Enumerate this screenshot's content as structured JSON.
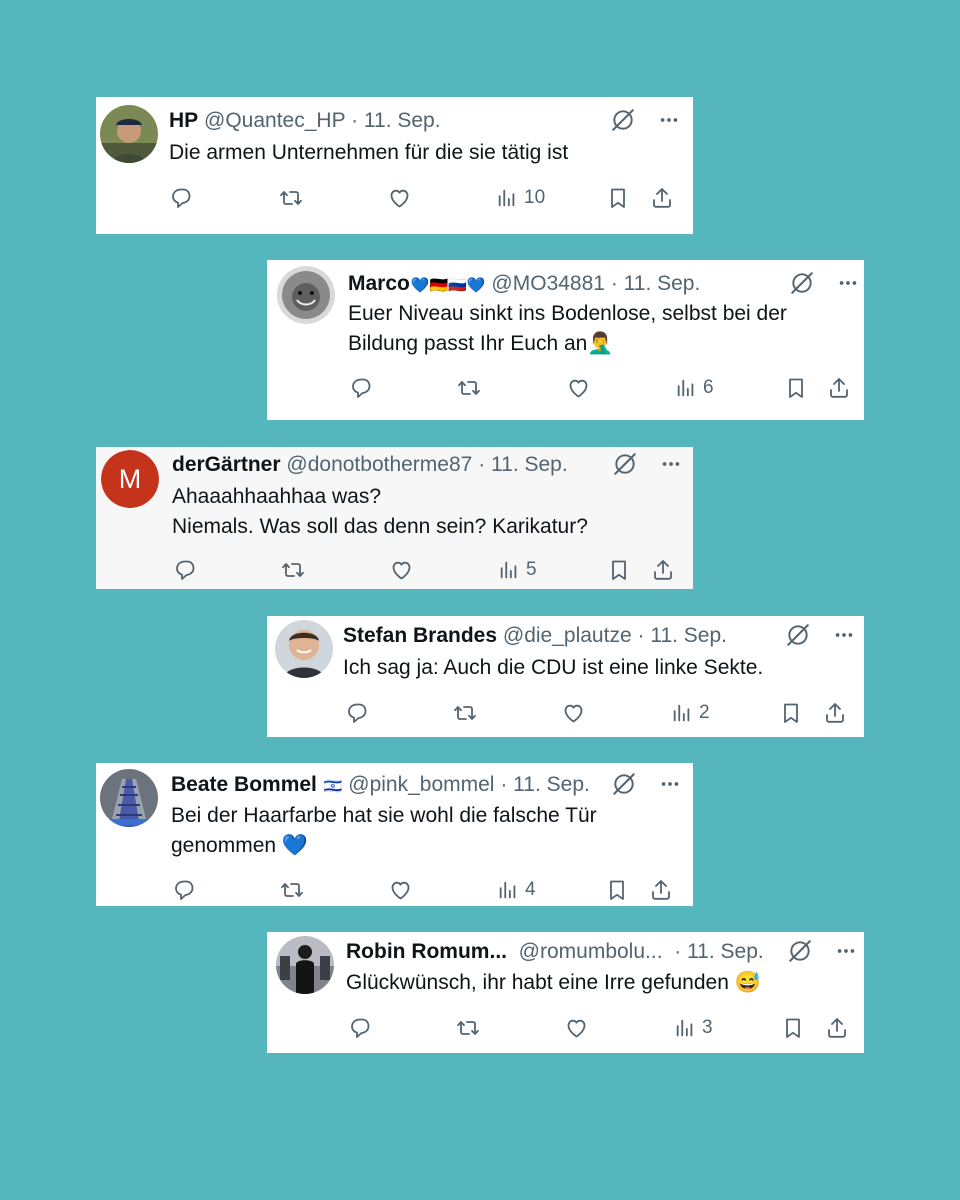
{
  "tweets": [
    {
      "name": "HP",
      "handle": "@Quantec_HP",
      "separator": "·",
      "date": "11. Sep.",
      "lines": [
        "Die armen Unternehmen für die sie tätig ist"
      ],
      "views": "10",
      "avatar_icon": "photo-avatar-cap"
    },
    {
      "name": "Marco",
      "name_suffix": "💙🇩🇪🇷🇺💙",
      "handle": "@MO34881",
      "separator": "·",
      "date": "11. Sep.",
      "lines": [
        "Euer Niveau sinkt ins Bodenlose, selbst bei der",
        "Bildung passt Ihr Euch an🤦‍♂️"
      ],
      "views": "6",
      "avatar_icon": "photo-avatar-lion"
    },
    {
      "name": "derGärtner",
      "handle": "@donotbotherme87",
      "separator": "·",
      "date": "11. Sep.",
      "lines": [
        "Ahaaahhaahhaa was?",
        "Niemals. Was soll das denn sein? Karikatur?"
      ],
      "views": "5",
      "avatar_letter": "M",
      "avatar_color": "#c6331b"
    },
    {
      "name": "Stefan Brandes",
      "handle": "@die_plautze",
      "separator": "·",
      "date": "11. Sep.",
      "lines": [
        "Ich sag ja: Auch die CDU ist eine linke Sekte."
      ],
      "views": "2",
      "avatar_icon": "photo-avatar-man"
    },
    {
      "name": "Beate Bommel",
      "name_suffix": "🇮🇱",
      "handle": "@pink_bommel",
      "separator": "·",
      "date": "11. Sep.",
      "lines": [
        "Bei der Haarfarbe hat sie wohl die falsche Tür",
        "genommen 💙"
      ],
      "views": "4",
      "avatar_icon": "photo-avatar-escalator"
    },
    {
      "name": "Robin Romum...",
      "handle": "@romumbolu...",
      "separator": "·",
      "date": "11. Sep.",
      "lines": [
        "Glückwünsch, ihr habt eine Irre gefunden 😅"
      ],
      "views": "3",
      "avatar_icon": "photo-avatar-gym"
    }
  ],
  "colors": {
    "background": "#55b7bd",
    "text": "#0f1419",
    "muted": "#536471"
  },
  "icons": [
    "reply-icon",
    "retweet-icon",
    "like-icon",
    "views-icon",
    "bookmark-icon",
    "share-icon",
    "grok-icon",
    "more-icon"
  ]
}
